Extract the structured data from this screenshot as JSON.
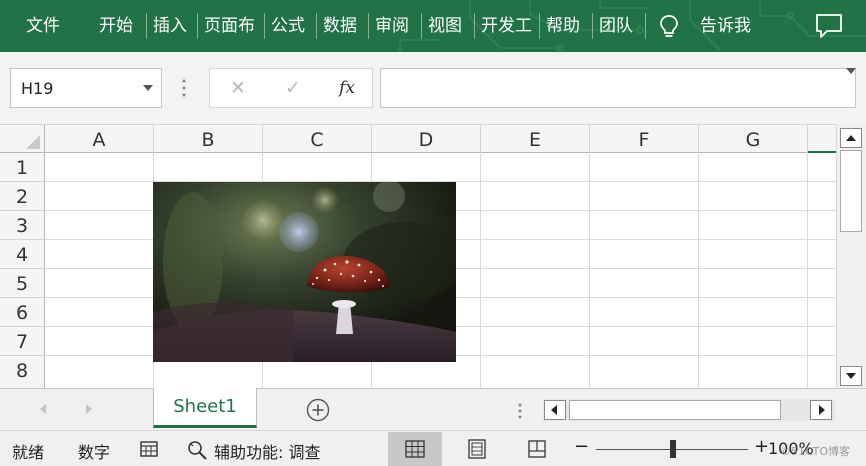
{
  "colors": {
    "ribbon": "#217346",
    "accent": "#217346",
    "header_bg": "#f5f5f5",
    "status_bg": "#f0f0f0"
  },
  "ribbon": {
    "tabs": [
      "文件",
      "开始",
      "插入",
      "页面布",
      "公式",
      "数据",
      "审阅",
      "视图",
      "开发工",
      "帮助",
      "团队",
      "告诉我"
    ],
    "icons": [
      "lightbulb-icon",
      "comment-icon"
    ]
  },
  "formula_bar": {
    "name_box": "H19",
    "cancel_glyph": "✕",
    "enter_glyph": "✓",
    "fx_glyph": "fx",
    "formula_value": ""
  },
  "grid": {
    "columns": [
      "A",
      "B",
      "C",
      "D",
      "E",
      "F",
      "G"
    ],
    "rows": [
      "1",
      "2",
      "3",
      "4",
      "5",
      "6",
      "7",
      "8"
    ],
    "picture": "mushroom-photo"
  },
  "sheet_tabs": {
    "sheets": [
      "Sheet1"
    ],
    "active": "Sheet1"
  },
  "status_bar": {
    "ready": "就绪",
    "mode": "数字",
    "accessibility": "辅助功能: 调查",
    "zoom_minus": "−",
    "zoom_plus": "+",
    "zoom": "100%",
    "watermark": "©51CTO博客"
  }
}
